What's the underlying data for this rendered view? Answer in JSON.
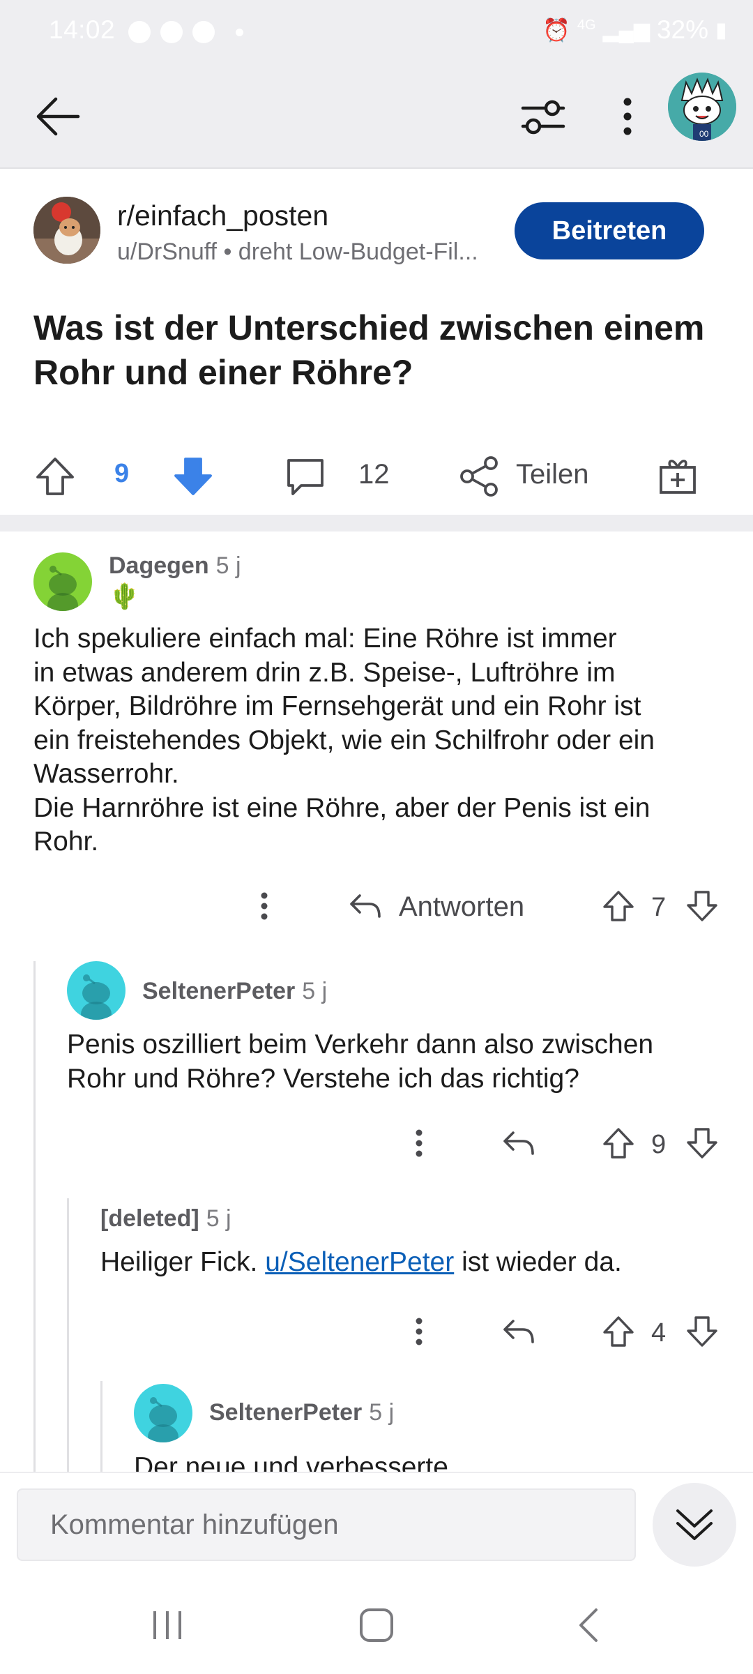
{
  "status_bar": {
    "time": "14:02",
    "network": "4G",
    "battery": "32%"
  },
  "post": {
    "subreddit": "r/einfach_posten",
    "meta": "u/DrSnuff • dreht Low-Budget-Fil...",
    "join_label": "Beitreten",
    "title": "Was ist der Unterschied zwischen einem Rohr und einer Röhre?",
    "score": "9",
    "comment_count": "12",
    "share_label": "Teilen"
  },
  "comments": [
    {
      "author": "Dagegen",
      "age": "5 j",
      "flair": "🌵",
      "body_lines": [
        "Ich spekuliere einfach mal: Eine Röhre ist immer",
        "in etwas anderem drin z.B. Speise-, Luftröhre im",
        "Körper, Bildröhre im Fernsehgerät und ein Rohr ist",
        "ein freistehendes Objekt, wie ein Schilfrohr oder ein",
        "Wasserrohr.",
        "Die Harnröhre ist eine Röhre, aber der Penis ist ein",
        "Rohr."
      ],
      "reply_label": "Antworten",
      "score": "7"
    },
    {
      "author": "SeltenerPeter",
      "age": "5 j",
      "body_lines": [
        "Penis oszilliert beim Verkehr dann also zwischen",
        "Rohr und Röhre? Verstehe ich das richtig?"
      ],
      "score": "9"
    },
    {
      "author": "[deleted]",
      "age": "5 j",
      "body_before": "Heiliger Fick. ",
      "body_link": "u/SeltenerPeter",
      "body_after": " ist wieder da.",
      "score": "4"
    },
    {
      "author": "SeltenerPeter",
      "age": "5 j",
      "body_lines": [
        "Der neue und verbesserte"
      ]
    }
  ],
  "composer": {
    "placeholder": "Kommentar hinzufügen"
  },
  "colors": {
    "accent": "#0a449b",
    "downvote": "#3b82e8",
    "link": "#0b5fb7"
  }
}
